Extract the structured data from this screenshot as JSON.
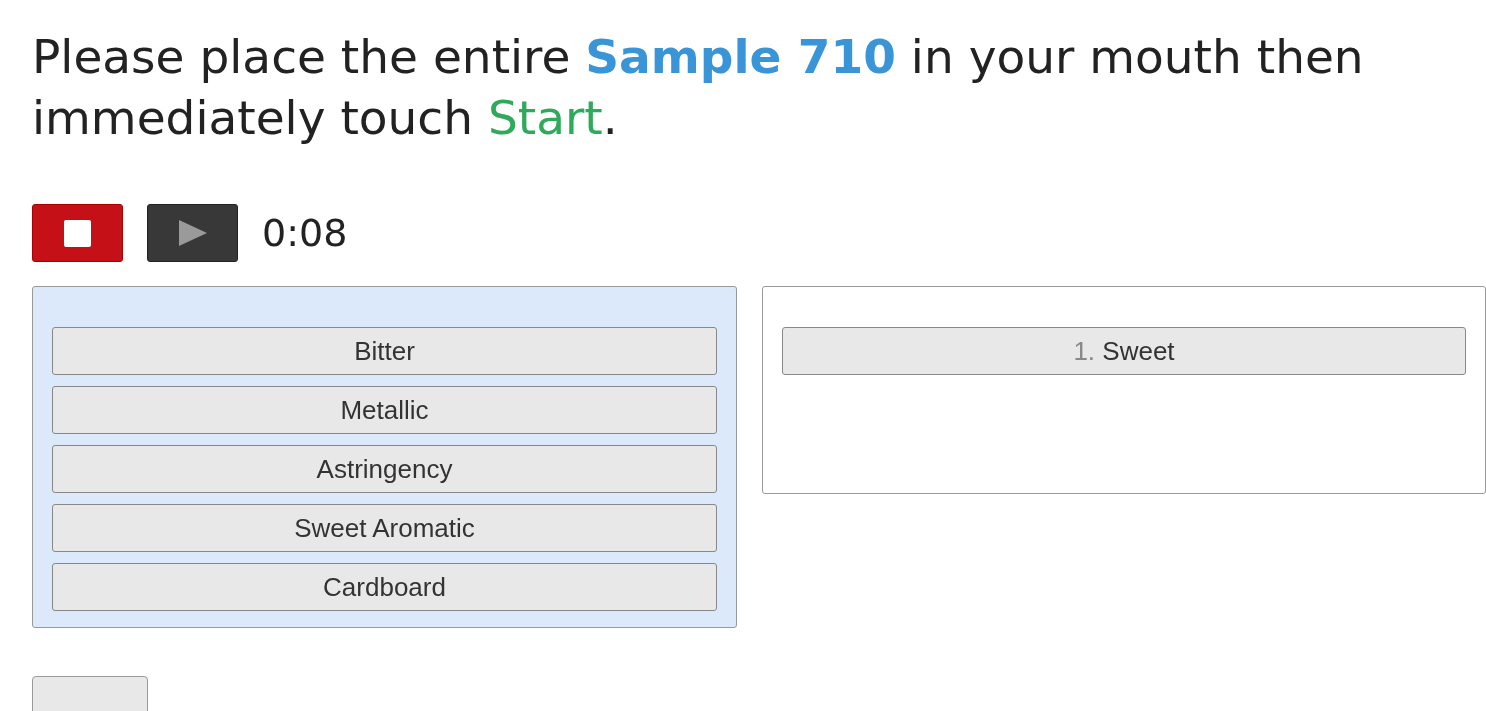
{
  "instruction": [
    {
      "text": "Please place the entire ",
      "kind": "plain"
    },
    {
      "text": "Sample 710",
      "kind": "sample"
    },
    {
      "text": " in your mouth then immediately touch ",
      "kind": "plain"
    },
    {
      "text": "Start",
      "kind": "start"
    },
    {
      "text": ".",
      "kind": "plain"
    }
  ],
  "timer": {
    "elapsed": "0:08"
  },
  "available": [
    {
      "label": "Bitter"
    },
    {
      "label": "Metallic"
    },
    {
      "label": "Astringency"
    },
    {
      "label": "Sweet Aromatic"
    },
    {
      "label": "Cardboard"
    }
  ],
  "ranked": [
    {
      "number": "1.",
      "label": "Sweet"
    }
  ]
}
